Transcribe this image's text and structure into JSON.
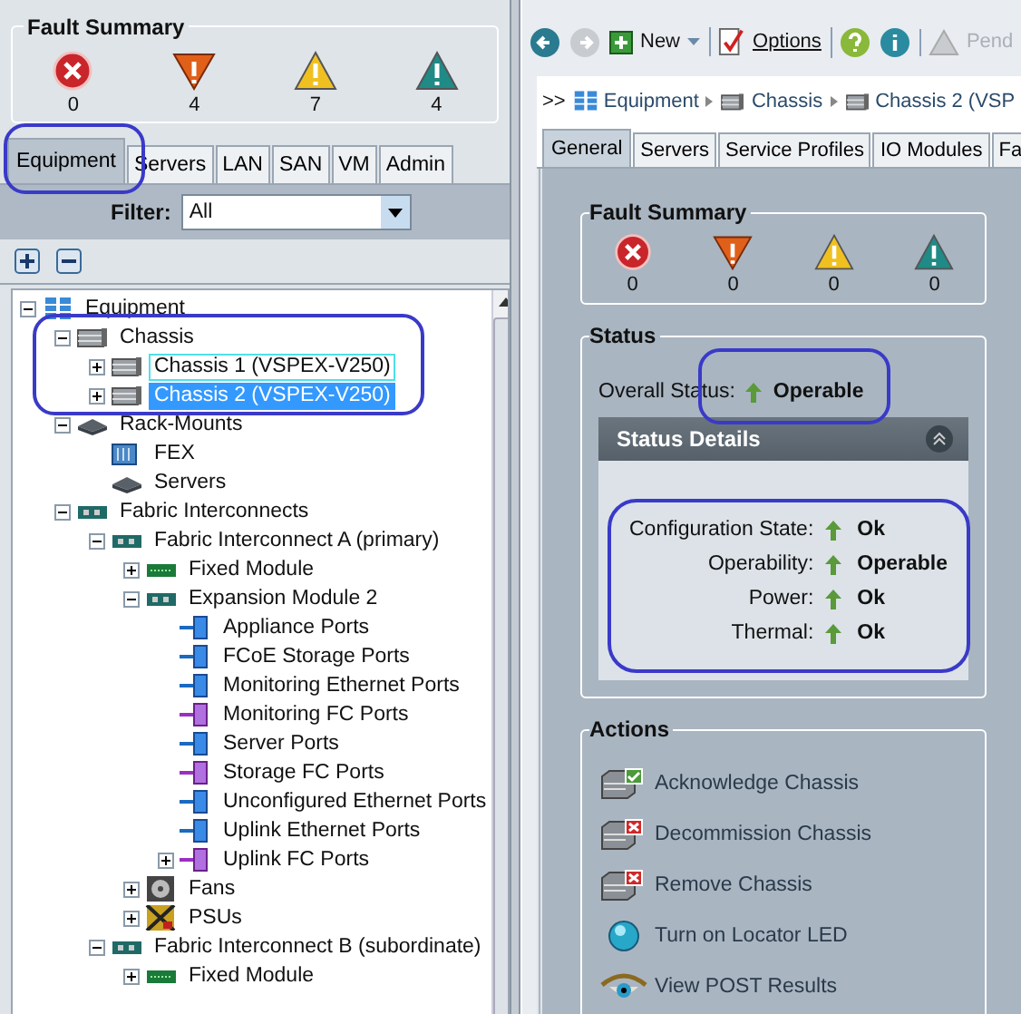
{
  "fault_summary": {
    "title": "Fault Summary",
    "faults": [
      {
        "kind": "critical",
        "count": "0"
      },
      {
        "kind": "major",
        "count": "4"
      },
      {
        "kind": "minor",
        "count": "7"
      },
      {
        "kind": "warning",
        "count": "4"
      }
    ]
  },
  "nav_tabs": [
    {
      "label": "Equipment",
      "selected": true
    },
    {
      "label": "Servers",
      "selected": false
    },
    {
      "label": "LAN",
      "selected": false
    },
    {
      "label": "SAN",
      "selected": false
    },
    {
      "label": "VM",
      "selected": false
    },
    {
      "label": "Admin",
      "selected": false
    }
  ],
  "filter": {
    "label": "Filter:",
    "value": "All"
  },
  "tree": [
    {
      "label": "Equipment",
      "kind": "equipment",
      "expanded": true,
      "selected": false,
      "children": [
        {
          "label": "Chassis",
          "kind": "chassis",
          "expanded": true,
          "selected": false,
          "children": [
            {
              "label": "Chassis 1 (VSPEX-V250)",
              "kind": "chassis",
              "expanded": false,
              "selected": false,
              "focused": true
            },
            {
              "label": "Chassis 2 (VSPEX-V250)",
              "kind": "chassis",
              "expanded": false,
              "selected": true,
              "focused": false
            }
          ]
        },
        {
          "label": "Rack-Mounts",
          "kind": "rack",
          "expanded": true,
          "selected": false,
          "children": [
            {
              "label": "FEX",
              "kind": "fex",
              "selected": false
            },
            {
              "label": "Servers",
              "kind": "rack",
              "selected": false
            }
          ]
        },
        {
          "label": "Fabric Interconnects",
          "kind": "fabric",
          "expanded": true,
          "selected": false,
          "children": [
            {
              "label": "Fabric Interconnect A (primary)",
              "kind": "fabric",
              "expanded": true,
              "selected": false,
              "children": [
                {
                  "label": "Fixed Module",
                  "kind": "module",
                  "expanded": false,
                  "selected": false
                },
                {
                  "label": "Expansion Module 2",
                  "kind": "fabric",
                  "expanded": true,
                  "selected": false,
                  "children": [
                    {
                      "label": "Appliance Ports",
                      "kind": "port-eth",
                      "selected": false
                    },
                    {
                      "label": "FCoE Storage Ports",
                      "kind": "port-eth",
                      "selected": false
                    },
                    {
                      "label": "Monitoring Ethernet Ports",
                      "kind": "port-eth",
                      "selected": false
                    },
                    {
                      "label": "Monitoring FC Ports",
                      "kind": "port-fc",
                      "selected": false
                    },
                    {
                      "label": "Server Ports",
                      "kind": "port-eth",
                      "selected": false
                    },
                    {
                      "label": "Storage FC Ports",
                      "kind": "port-fc",
                      "selected": false
                    },
                    {
                      "label": "Unconfigured Ethernet Ports",
                      "kind": "port-eth",
                      "selected": false
                    },
                    {
                      "label": "Uplink Ethernet Ports",
                      "kind": "port-eth",
                      "selected": false
                    },
                    {
                      "label": "Uplink FC Ports",
                      "kind": "port-fc",
                      "expanded": false,
                      "selected": false
                    }
                  ]
                },
                {
                  "label": "Fans",
                  "kind": "fan",
                  "expanded": false,
                  "selected": false
                },
                {
                  "label": "PSUs",
                  "kind": "psu",
                  "expanded": false,
                  "selected": false
                }
              ]
            },
            {
              "label": "Fabric Interconnect B (subordinate)",
              "kind": "fabric",
              "expanded": true,
              "selected": false,
              "children": [
                {
                  "label": "Fixed Module",
                  "kind": "module",
                  "expanded": false,
                  "selected": false
                }
              ]
            }
          ]
        }
      ]
    }
  ],
  "toolbar": [
    {
      "kind": "back",
      "disabled": false
    },
    {
      "kind": "forward",
      "disabled": true
    },
    {
      "kind": "new",
      "label": "New"
    },
    {
      "kind": "options",
      "label": "Options"
    },
    {
      "kind": "help"
    },
    {
      "kind": "info"
    },
    {
      "kind": "pending",
      "label": "Pend",
      "disabled": true
    }
  ],
  "breadcrumb": {
    "prefix": ">>",
    "items": [
      {
        "label": "Equipment",
        "kind": "equipment"
      },
      {
        "label": "Chassis",
        "kind": "chassis"
      },
      {
        "label": "Chassis 2 (VSP",
        "kind": "chassis"
      }
    ]
  },
  "detail_tabs": [
    {
      "label": "General",
      "selected": true
    },
    {
      "label": "Servers",
      "selected": false
    },
    {
      "label": "Service Profiles",
      "selected": false
    },
    {
      "label": "IO Modules",
      "selected": false
    },
    {
      "label": "Fa",
      "selected": false
    }
  ],
  "detail_fault_summary": {
    "title": "Fault Summary",
    "faults": [
      {
        "kind": "critical",
        "count": "0"
      },
      {
        "kind": "major",
        "count": "0"
      },
      {
        "kind": "minor",
        "count": "0"
      },
      {
        "kind": "warning",
        "count": "0"
      }
    ]
  },
  "status": {
    "title": "Status",
    "overall_label": "Overall Status:",
    "overall_value": "Operable",
    "details_title": "Status Details",
    "details": [
      {
        "label": "Configuration State:",
        "value": "Ok"
      },
      {
        "label": "Operability:",
        "value": "Operable"
      },
      {
        "label": "Power:",
        "value": "Ok"
      },
      {
        "label": "Thermal:",
        "value": "Ok"
      }
    ]
  },
  "actions": {
    "title": "Actions",
    "items": [
      {
        "label": "Acknowledge Chassis",
        "kind": "chassis-check"
      },
      {
        "label": "Decommission Chassis",
        "kind": "chassis-x"
      },
      {
        "label": "Remove Chassis",
        "kind": "chassis-x"
      },
      {
        "label": "Turn on Locator LED",
        "kind": "led"
      },
      {
        "label": "View POST Results",
        "kind": "eye"
      }
    ]
  }
}
